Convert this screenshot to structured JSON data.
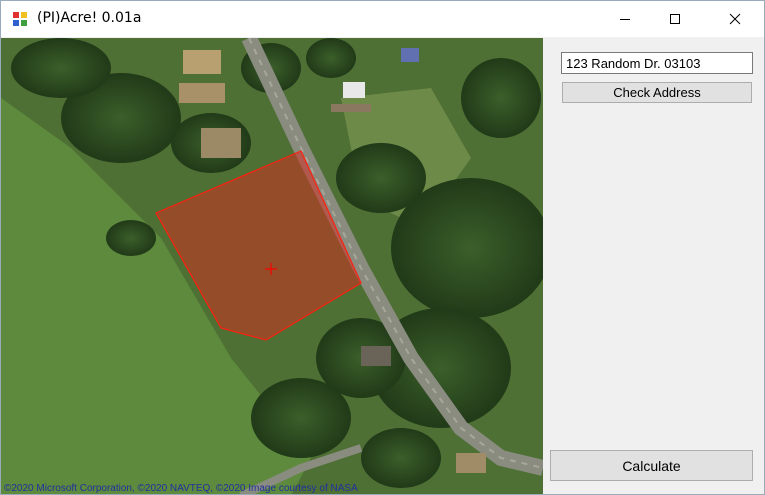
{
  "window": {
    "title": "(PI)Acre! 0.01a",
    "icon": "app-tiles-icon",
    "controls": {
      "minimize": "—",
      "maximize": "☐",
      "close": "✕"
    }
  },
  "map": {
    "copyright": "©2020 Microsoft Corporation, ©2020 NAVTEQ, ©2020 Image courtesy of NASA",
    "parcel_color": "#d03020",
    "marker_color": "#ff0000",
    "marker_icon": "crosshair-icon"
  },
  "sidebar": {
    "address_value": "123 Random Dr. 03103",
    "check_address_label": "Check Address",
    "calculate_label": "Calculate"
  }
}
